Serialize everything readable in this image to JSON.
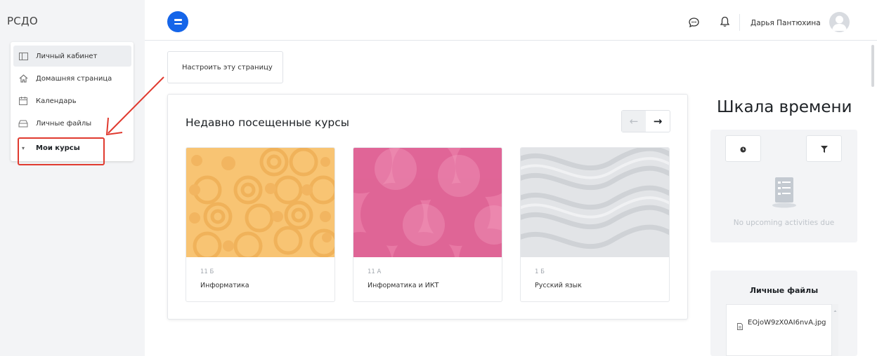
{
  "app": {
    "brand": "РСДО"
  },
  "sidebar": {
    "items": [
      {
        "label": "Личный кабинет",
        "icon": "dashboard-icon"
      },
      {
        "label": "Домашняя страница",
        "icon": "home-icon"
      },
      {
        "label": "Календарь",
        "icon": "calendar-icon"
      },
      {
        "label": "Личные файлы",
        "icon": "files-icon"
      },
      {
        "label": "Мои курсы",
        "icon": "caret-down-icon"
      }
    ]
  },
  "header": {
    "user_name": "Дарья Пантюхина"
  },
  "main": {
    "customize_label": "Настроить эту страницу",
    "recent": {
      "title": "Недавно посещенные курсы",
      "prev_glyph": "←",
      "next_glyph": "→",
      "courses": [
        {
          "category": "11 Б",
          "name": "Информатика",
          "color": "#f8c473"
        },
        {
          "category": "11 А",
          "name": "Информатика и ИКТ",
          "color": "#e878a4"
        },
        {
          "category": "1 Б",
          "name": "Русский язык",
          "color": "#e2e4e7"
        }
      ]
    }
  },
  "timeline": {
    "title": "Шкала времени",
    "empty_text": "No upcoming activities due"
  },
  "files": {
    "title": "Личные файлы",
    "items": [
      {
        "name": "EOjoW9zX0AI6nvA.jpg"
      }
    ]
  },
  "colors": {
    "accent": "#1565e9",
    "highlight": "#e03a2f"
  }
}
